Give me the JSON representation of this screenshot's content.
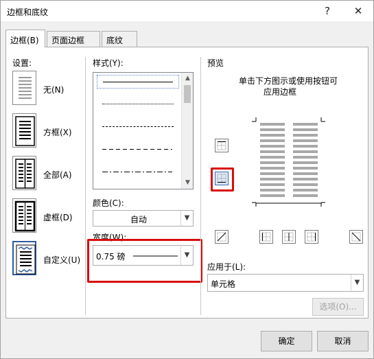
{
  "window": {
    "title": "边框和底纹",
    "help": "?",
    "close": "✕"
  },
  "tabs": [
    {
      "label": "边框(B)",
      "active": true
    },
    {
      "label": "页面边框(P)",
      "active": false
    },
    {
      "label": "底纹(S)",
      "active": false
    }
  ],
  "settings": {
    "heading": "设置:",
    "items": [
      {
        "label": "无(N)",
        "icon": "setting-none-icon"
      },
      {
        "label": "方框(X)",
        "icon": "setting-box-icon"
      },
      {
        "label": "全部(A)",
        "icon": "setting-all-icon"
      },
      {
        "label": "虚框(D)",
        "icon": "setting-grid-icon"
      },
      {
        "label": "自定义(U)",
        "icon": "setting-custom-icon",
        "selected": true
      }
    ]
  },
  "style": {
    "heading": "样式(Y):",
    "lines": [
      "solid",
      "dotted",
      "dashed-fine",
      "dashed",
      "dash-dot"
    ],
    "selected_index": 0
  },
  "color": {
    "heading": "颜色(C):",
    "value": "自动"
  },
  "width": {
    "heading": "宽度(W):",
    "value": "0.75 磅"
  },
  "preview": {
    "heading": "预览",
    "instruction_line1": "单击下方图示或使用按钮可",
    "instruction_line2": "应用边框"
  },
  "apply_to": {
    "heading": "应用于(L):",
    "value": "单元格"
  },
  "options_button": "选项(O)...",
  "ok_button": "确定",
  "cancel_button": "取消",
  "colors": {
    "highlight": "#d80d0d",
    "selection": "#2b5aa0"
  }
}
